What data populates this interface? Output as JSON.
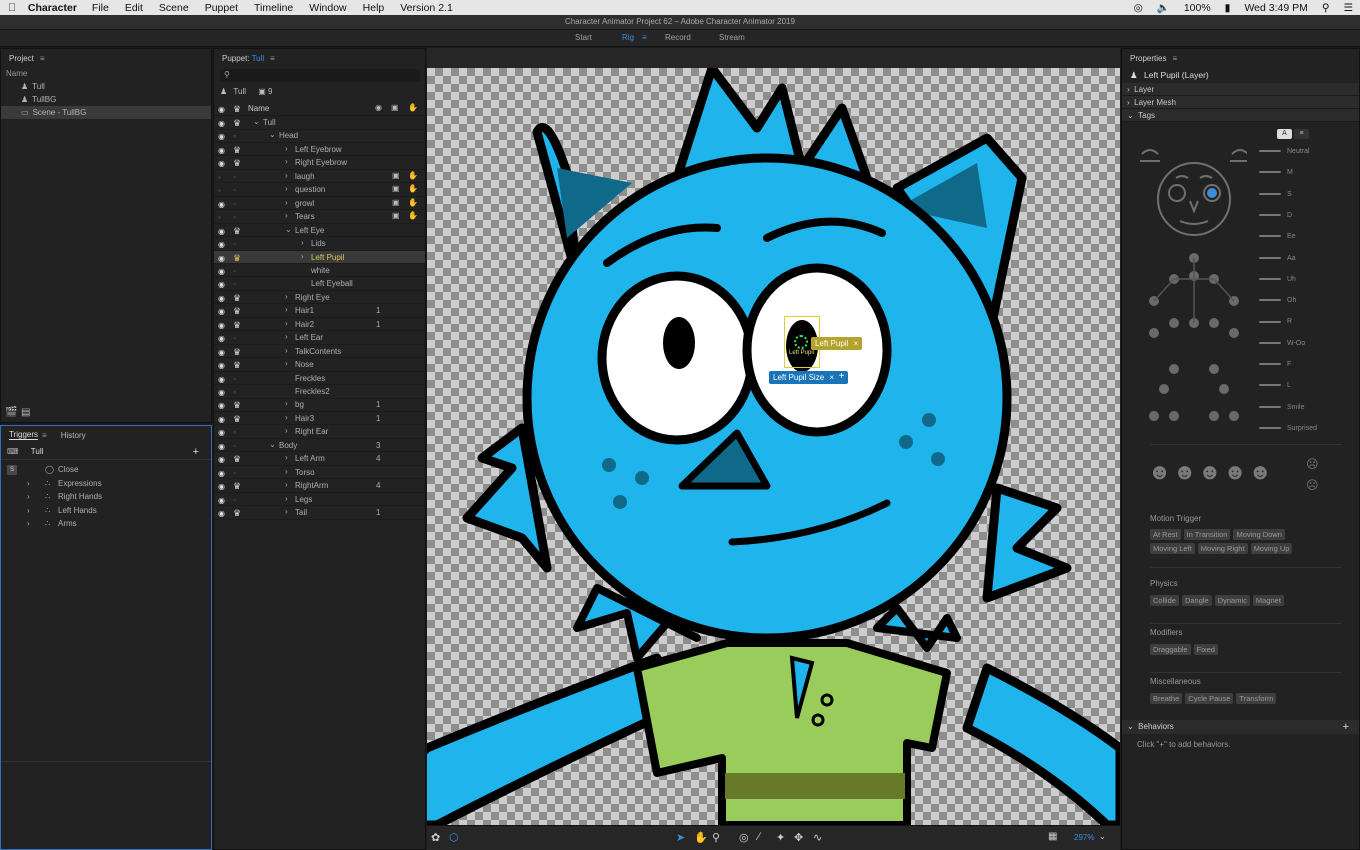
{
  "menubar": {
    "app": "Character",
    "items": [
      "File",
      "Edit",
      "Scene",
      "Puppet",
      "Timeline",
      "Window",
      "Help",
      "Version 2.1"
    ],
    "battery": "100%",
    "clock": "Wed 3:49 PM"
  },
  "window_title": "Character Animator Project 62 – Adobe Character Animator 2019",
  "workspaces": [
    "Start",
    "Rig",
    "Record",
    "Stream"
  ],
  "active_workspace": "Rig",
  "project": {
    "title": "Project",
    "column": "Name",
    "items": [
      "Tull",
      "TullBG",
      "Scene - TullBG"
    ]
  },
  "triggers": {
    "tab_triggers": "Triggers",
    "tab_history": "History",
    "puppet": "Tull",
    "add": "+",
    "items": [
      {
        "label": "Close",
        "key": "S"
      },
      {
        "label": "Expressions"
      },
      {
        "label": "Right Hands"
      },
      {
        "label": "Left Hands"
      },
      {
        "label": "Arms"
      }
    ]
  },
  "puppet_panel": {
    "title": "Puppet:",
    "puppet_name": "Tull",
    "search_placeholder": "",
    "root_name": "Tull",
    "count": "9",
    "column_name": "Name",
    "rows": [
      {
        "label": "Tull",
        "indent": 0,
        "arrow": "v",
        "eye": true,
        "crown": true
      },
      {
        "label": "Head",
        "indent": 1,
        "arrow": "v",
        "eye": true,
        "crown": false
      },
      {
        "label": "Left Eyebrow",
        "indent": 2,
        "arrow": ">",
        "eye": true,
        "crown": true
      },
      {
        "label": "Right Eyebrow",
        "indent": 2,
        "arrow": ">",
        "eye": true,
        "crown": true
      },
      {
        "label": "laugh",
        "indent": 2,
        "arrow": ">",
        "eye": false,
        "crown": false,
        "icons": true
      },
      {
        "label": "question",
        "indent": 2,
        "arrow": ">",
        "eye": false,
        "crown": false,
        "icons": true
      },
      {
        "label": "growl",
        "indent": 2,
        "arrow": ">",
        "eye": true,
        "crown": false,
        "icons": true
      },
      {
        "label": "Tears",
        "indent": 2,
        "arrow": ">",
        "eye": false,
        "crown": false,
        "icons": true
      },
      {
        "label": "Left Eye",
        "indent": 2,
        "arrow": "v",
        "eye": true,
        "crown": true
      },
      {
        "label": "Lids",
        "indent": 3,
        "arrow": ">",
        "eye": true,
        "crown": false
      },
      {
        "label": "Left Pupil",
        "indent": 3,
        "arrow": ">",
        "eye": true,
        "crown": true,
        "selected": true
      },
      {
        "label": "white",
        "indent": 3,
        "arrow": "",
        "eye": true,
        "crown": false
      },
      {
        "label": "Left Eyeball",
        "indent": 3,
        "arrow": "",
        "eye": true,
        "crown": false
      },
      {
        "label": "Right Eye",
        "indent": 2,
        "arrow": ">",
        "eye": true,
        "crown": true
      },
      {
        "label": "Hair1",
        "indent": 2,
        "arrow": ">",
        "eye": true,
        "crown": true,
        "num": "1"
      },
      {
        "label": "Hair2",
        "indent": 2,
        "arrow": ">",
        "eye": true,
        "crown": true,
        "num": "1"
      },
      {
        "label": "Left Ear",
        "indent": 2,
        "arrow": ">",
        "eye": true,
        "crown": false
      },
      {
        "label": "TalkContents",
        "indent": 2,
        "arrow": ">",
        "eye": true,
        "crown": true
      },
      {
        "label": "Nose",
        "indent": 2,
        "arrow": ">",
        "eye": true,
        "crown": true
      },
      {
        "label": "Freckles",
        "indent": 2,
        "arrow": "",
        "eye": true,
        "crown": false
      },
      {
        "label": "Freckles2",
        "indent": 2,
        "arrow": "",
        "eye": true,
        "crown": false
      },
      {
        "label": "bg",
        "indent": 2,
        "arrow": ">",
        "eye": true,
        "crown": true,
        "num": "1"
      },
      {
        "label": "Hair3",
        "indent": 2,
        "arrow": ">",
        "eye": true,
        "crown": true,
        "num": "1"
      },
      {
        "label": "Right Ear",
        "indent": 2,
        "arrow": ">",
        "eye": true,
        "crown": false
      },
      {
        "label": "Body",
        "indent": 1,
        "arrow": "v",
        "eye": true,
        "crown": false,
        "num": "3"
      },
      {
        "label": "Left Arm",
        "indent": 2,
        "arrow": ">",
        "eye": true,
        "crown": true,
        "num": "4"
      },
      {
        "label": "Torso",
        "indent": 2,
        "arrow": ">",
        "eye": true,
        "crown": false
      },
      {
        "label": "RightArm",
        "indent": 2,
        "arrow": ">",
        "eye": true,
        "crown": true,
        "num": "4"
      },
      {
        "label": "Legs",
        "indent": 2,
        "arrow": ">",
        "eye": true,
        "crown": false
      },
      {
        "label": "Tail",
        "indent": 2,
        "arrow": ">",
        "eye": true,
        "crown": true,
        "num": "1"
      }
    ]
  },
  "canvas": {
    "handle_tag": "Left Pupil",
    "handle_small": "Left Pupil",
    "size_tag": "Left Pupil Size",
    "add": "+",
    "zoom": "297%"
  },
  "properties": {
    "title": "Properties",
    "selection": "Left Pupil (Layer)",
    "sections": {
      "layer": "Layer",
      "mesh": "Layer Mesh",
      "tags": "Tags"
    },
    "mouth_tags": [
      "Neutral",
      "M",
      "S",
      "D",
      "Ee",
      "Aa",
      "Uh",
      "Oh",
      "R",
      "W-Oo",
      "F",
      "L",
      "Smile",
      "Surprised"
    ],
    "groups": [
      {
        "name": "Motion Trigger",
        "tags": [
          "At Rest",
          "In Transition",
          "Moving Down",
          "Moving Left",
          "Moving Right",
          "Moving Up"
        ]
      },
      {
        "name": "Physics",
        "tags": [
          "Collide",
          "Dangle",
          "Dynamic",
          "Magnet"
        ]
      },
      {
        "name": "Modifiers",
        "tags": [
          "Draggable",
          "Fixed"
        ]
      },
      {
        "name": "Miscellaneous",
        "tags": [
          "Breathe",
          "Cycle Pause",
          "Transform"
        ]
      }
    ],
    "behaviors_title": "Behaviors",
    "behaviors_hint": "Click \"+\" to add behaviors."
  },
  "colors": {
    "accent": "#3d8ce0",
    "selected_tag": "#b3a22c",
    "size_tag": "#1a74b8",
    "character": "#1fb4ec",
    "shirt": "#99cc5a"
  }
}
